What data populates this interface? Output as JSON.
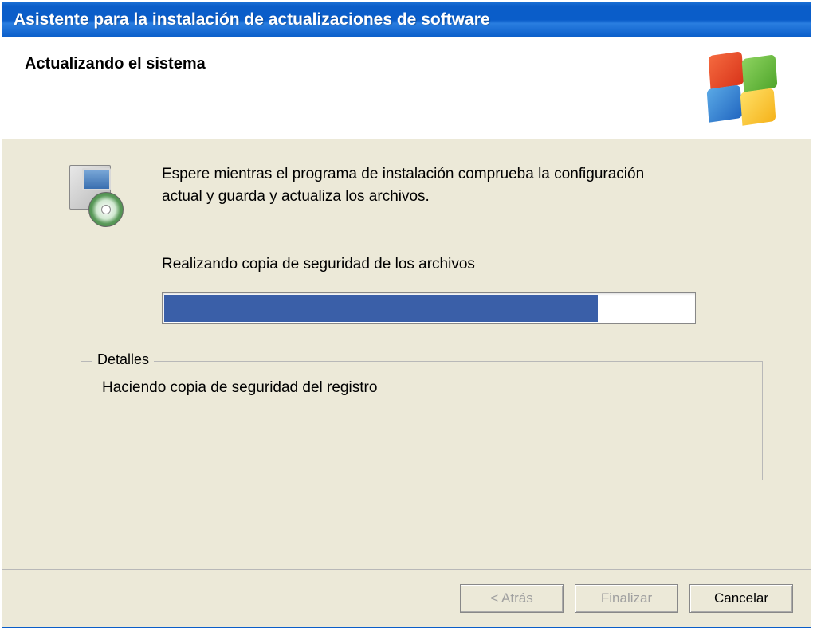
{
  "window": {
    "title": "Asistente para la instalación de actualizaciones de software"
  },
  "header": {
    "title": "Actualizando el sistema"
  },
  "main": {
    "instruction": "Espere mientras el programa de instalación comprueba la configuración actual y guarda y actualiza los archivos.",
    "progress_label": "Realizando copia de seguridad de los archivos",
    "progress_percent": 82
  },
  "details": {
    "legend": "Detalles",
    "text": "Haciendo copia de seguridad del registro"
  },
  "buttons": {
    "back": "< Atrás",
    "finish": "Finalizar",
    "cancel": "Cancelar"
  },
  "colors": {
    "titlebar": "#0a5dc9",
    "progress_fill": "#3a5fa8",
    "panel_bg": "#ece9d8"
  }
}
